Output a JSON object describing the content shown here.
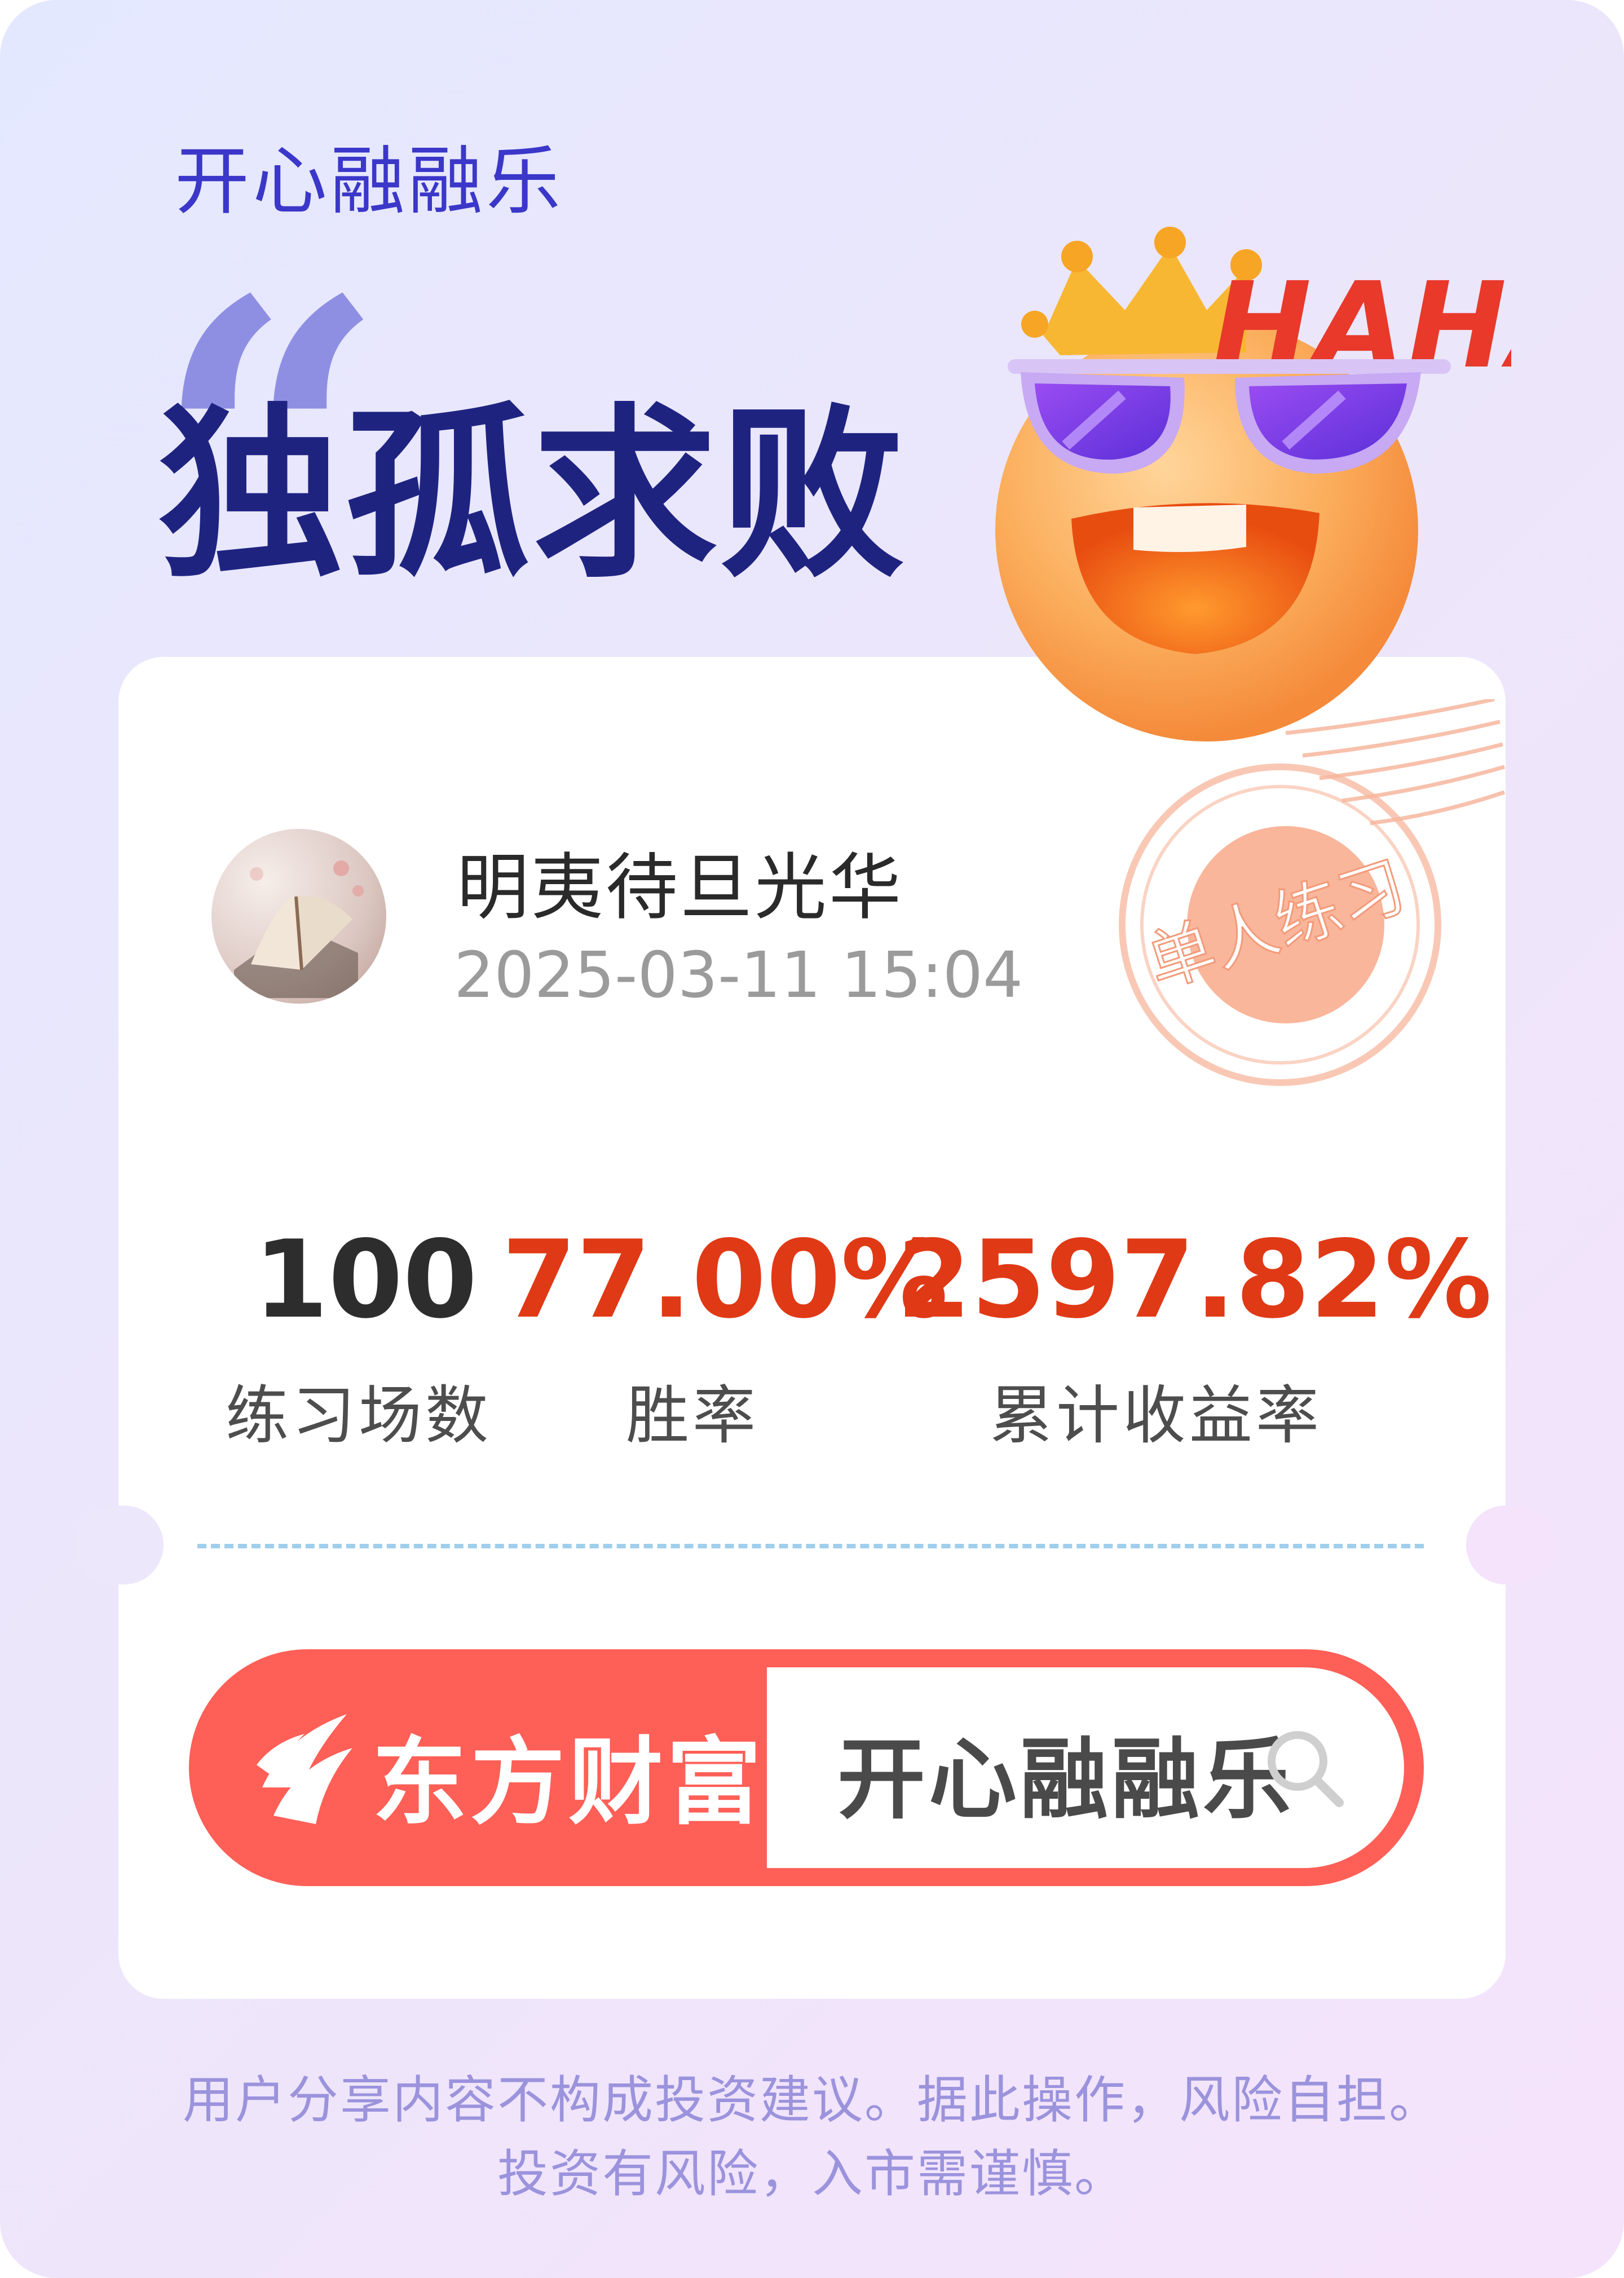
{
  "header": {
    "app_title": "开心融融乐",
    "quote_mark": "“",
    "headline": "独孤求败"
  },
  "sticker": {
    "haha_text": "HAHA",
    "stamp_text": "单人练习"
  },
  "user": {
    "name": "明夷待旦光华",
    "timestamp": "2025-03-11 15:04"
  },
  "stats": [
    {
      "value": "100",
      "label": "练习场数"
    },
    {
      "value": "77.00%",
      "label": "胜率"
    },
    {
      "value": "2597.82%",
      "label": "累计收益率"
    }
  ],
  "search_bar": {
    "brand_name": "东方财富",
    "query": "开心融融乐",
    "icon": "search-icon"
  },
  "colors": {
    "accent_red": "#e03916",
    "brand_red": "#fe5f57",
    "headline_navy": "#1f2380",
    "title_blue": "#3b37c9"
  },
  "disclaimer": {
    "line1": "用户分享内容不构成投资建议。据此操作，风险自担。",
    "line2": "投资有风险，入市需谨慎。"
  }
}
